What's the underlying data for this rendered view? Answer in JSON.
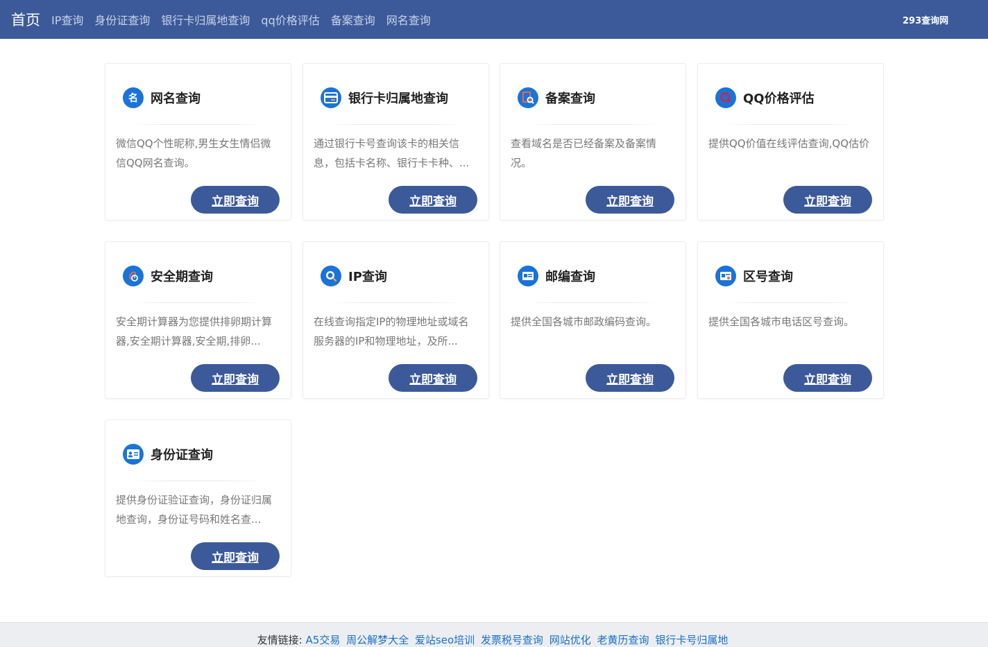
{
  "nav": {
    "brand": "首页",
    "links": [
      "IP查询",
      "身份证查询",
      "银行卡归属地查询",
      "qq价格评估",
      "备案查询",
      "网名查询"
    ],
    "site_name": "293查询网"
  },
  "cards": [
    {
      "icon": "name-tag-icon",
      "title": "网名查询",
      "desc": "微信QQ个性昵称,男生女生情侣微信QQ网名查询。",
      "button": "立即查询"
    },
    {
      "icon": "bank-card-icon",
      "title": "银行卡归属地查询",
      "desc": "通过银行卡号查询该卡的相关信息，包括卡名称、银行卡卡种、...",
      "button": "立即查询"
    },
    {
      "icon": "record-search-icon",
      "title": "备案查询",
      "desc": "查看域名是否已经备案及备案情况。",
      "button": "立即查询"
    },
    {
      "icon": "qq-icon",
      "title": "QQ价格评估",
      "desc": "提供QQ价值在线评估查询,QQ估价",
      "button": "立即查询"
    },
    {
      "icon": "safe-period-icon",
      "title": "安全期查询",
      "desc": "安全期计算器为您提供排卵期计算器,安全期计算器,安全期,排卵...",
      "button": "立即查询"
    },
    {
      "icon": "ip-search-icon",
      "title": "IP查询",
      "desc": "在线查询指定IP的物理地址或域名服务器的IP和物理地址，及所...",
      "button": "立即查询"
    },
    {
      "icon": "postcode-icon",
      "title": "邮编查询",
      "desc": "提供全国各城市邮政编码查询。",
      "button": "立即查询"
    },
    {
      "icon": "area-code-icon",
      "title": "区号查询",
      "desc": "提供全国各城市电话区号查询。",
      "button": "立即查询"
    },
    {
      "icon": "id-card-icon",
      "title": "身份证查询",
      "desc": "提供身份证验证查询，身份证归属地查询，身份证号码和姓名查...",
      "button": "立即查询"
    }
  ],
  "footer": {
    "label": "友情链接:",
    "links": [
      "A5交易",
      "周公解梦大全",
      "爱站seo培训",
      "发票税号查询",
      "网站优化",
      "老黄历查询",
      "银行卡号归属地"
    ]
  },
  "colors": {
    "nav_bg": "#3c5a99",
    "button_bg": "#3c5a99",
    "icon_blue": "#1a73d9",
    "link": "#1a6fc4"
  }
}
